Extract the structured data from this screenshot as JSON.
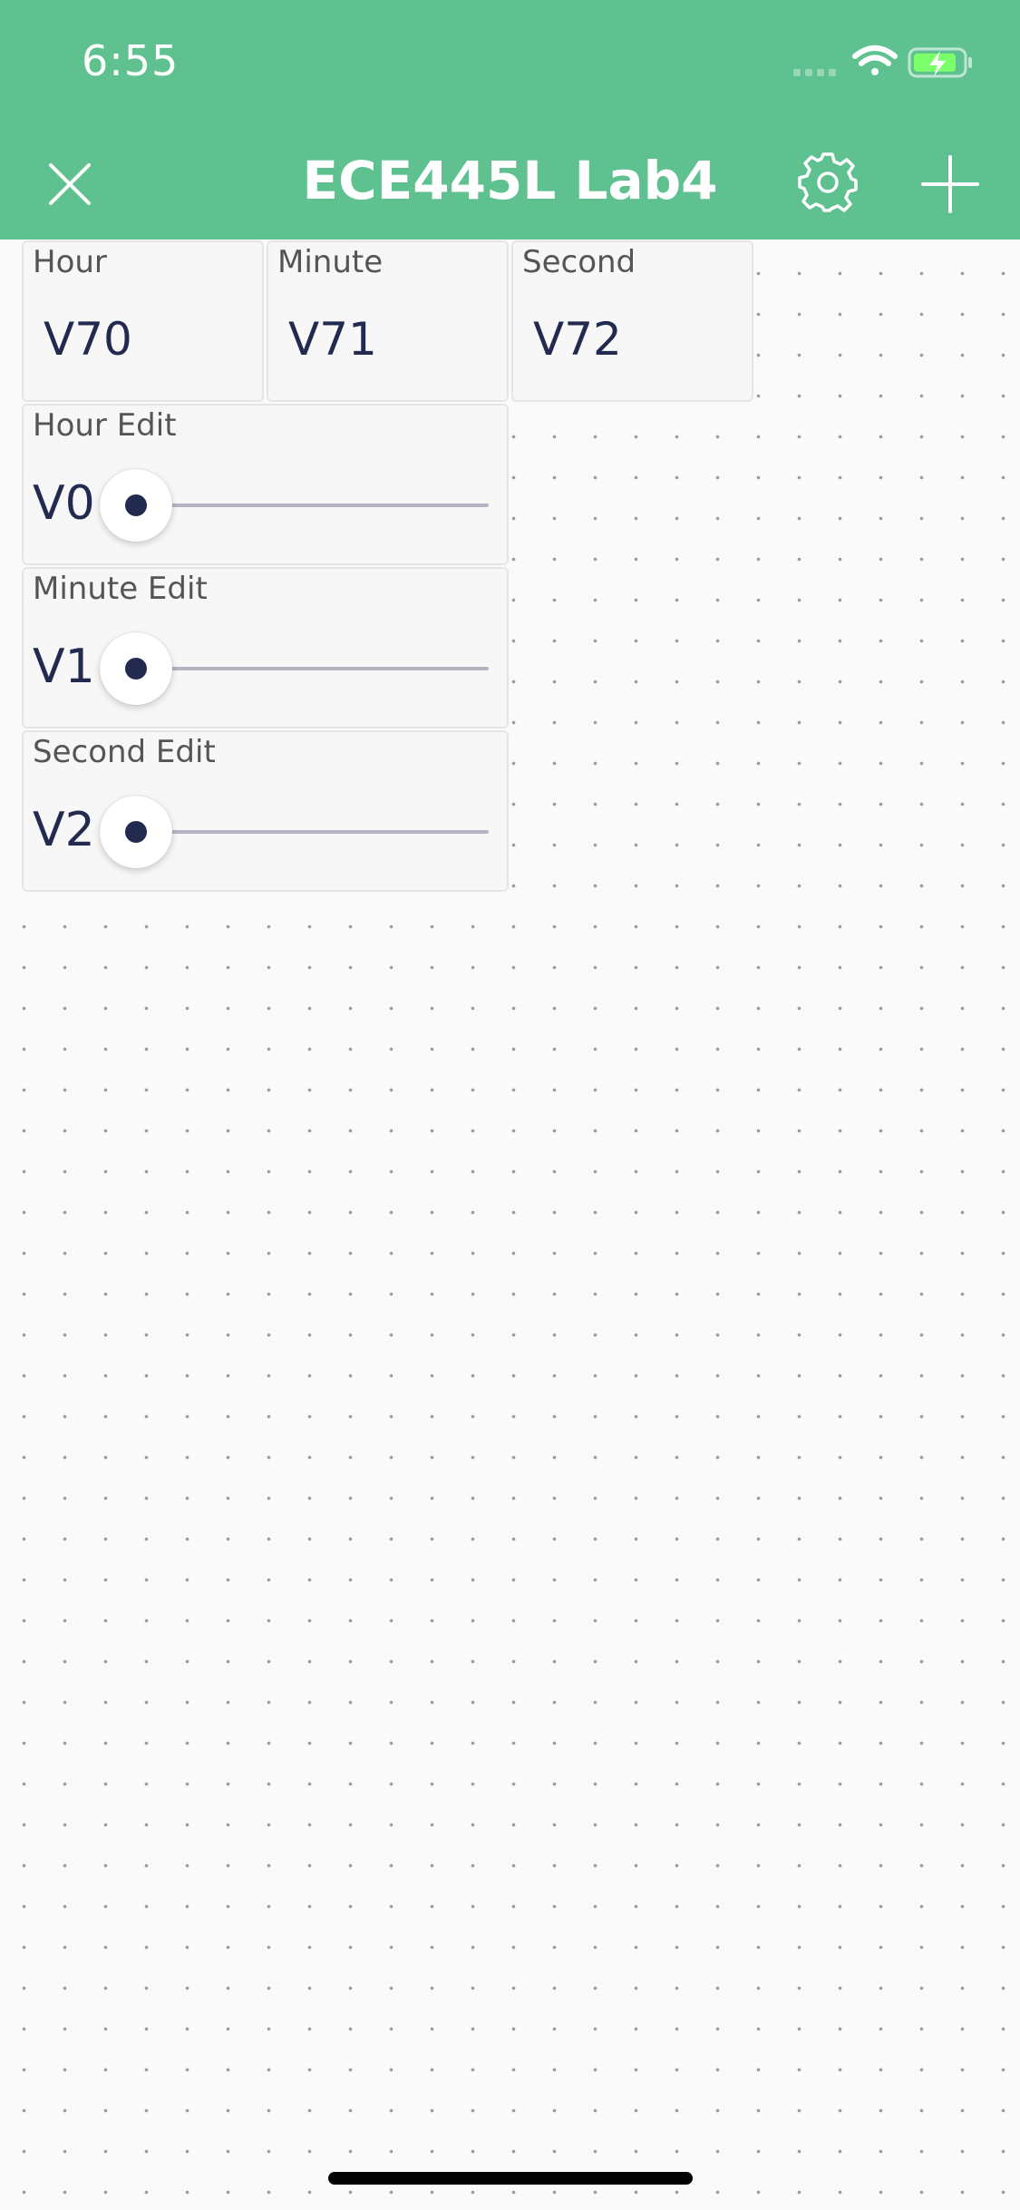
{
  "status_bar": {
    "time": "6:55"
  },
  "app_bar": {
    "title": "ECE445L Lab4",
    "background_color": "#5fc190",
    "icons": [
      "close-icon",
      "gear-icon",
      "plus-icon"
    ]
  },
  "widgets": {
    "hour_display": {
      "label": "Hour",
      "value": "V70"
    },
    "minute_display": {
      "label": "Minute",
      "value": "V71"
    },
    "second_display": {
      "label": "Second",
      "value": "V72"
    },
    "hour_slider": {
      "label": "Hour Edit",
      "pin": "V0",
      "level": 0
    },
    "minute_slider": {
      "label": "Minute Edit",
      "pin": "V1",
      "level": 0
    },
    "second_slider": {
      "label": "Second Edit",
      "pin": "V2",
      "level": 0
    }
  },
  "colors": {
    "accent": "#5fc190",
    "value_text": "#222a50",
    "slider_track": "#b4b4c2"
  }
}
